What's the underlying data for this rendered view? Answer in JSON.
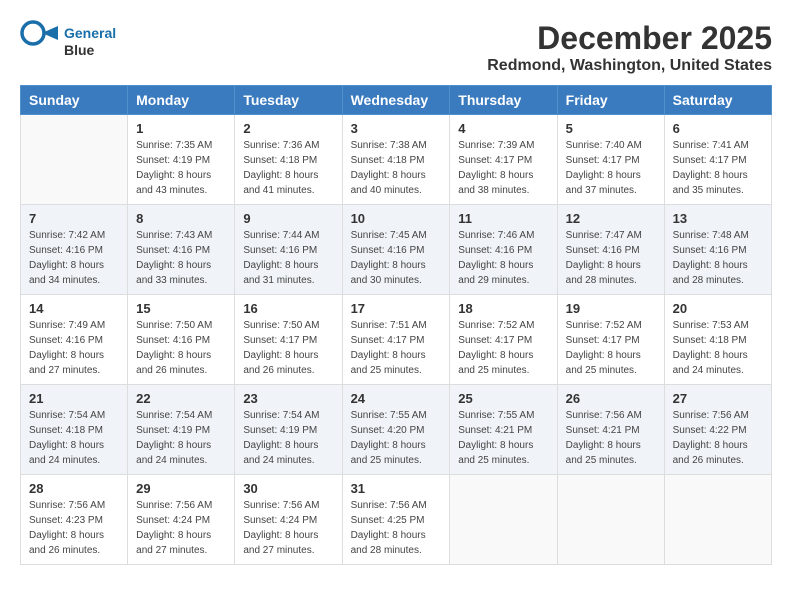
{
  "logo": {
    "line1": "General",
    "line2": "Blue"
  },
  "title": "December 2025",
  "location": "Redmond, Washington, United States",
  "weekdays": [
    "Sunday",
    "Monday",
    "Tuesday",
    "Wednesday",
    "Thursday",
    "Friday",
    "Saturday"
  ],
  "weeks": [
    [
      {
        "day": "",
        "sunrise": "",
        "sunset": "",
        "daylight": ""
      },
      {
        "day": "1",
        "sunrise": "Sunrise: 7:35 AM",
        "sunset": "Sunset: 4:19 PM",
        "daylight": "Daylight: 8 hours and 43 minutes."
      },
      {
        "day": "2",
        "sunrise": "Sunrise: 7:36 AM",
        "sunset": "Sunset: 4:18 PM",
        "daylight": "Daylight: 8 hours and 41 minutes."
      },
      {
        "day": "3",
        "sunrise": "Sunrise: 7:38 AM",
        "sunset": "Sunset: 4:18 PM",
        "daylight": "Daylight: 8 hours and 40 minutes."
      },
      {
        "day": "4",
        "sunrise": "Sunrise: 7:39 AM",
        "sunset": "Sunset: 4:17 PM",
        "daylight": "Daylight: 8 hours and 38 minutes."
      },
      {
        "day": "5",
        "sunrise": "Sunrise: 7:40 AM",
        "sunset": "Sunset: 4:17 PM",
        "daylight": "Daylight: 8 hours and 37 minutes."
      },
      {
        "day": "6",
        "sunrise": "Sunrise: 7:41 AM",
        "sunset": "Sunset: 4:17 PM",
        "daylight": "Daylight: 8 hours and 35 minutes."
      }
    ],
    [
      {
        "day": "7",
        "sunrise": "Sunrise: 7:42 AM",
        "sunset": "Sunset: 4:16 PM",
        "daylight": "Daylight: 8 hours and 34 minutes."
      },
      {
        "day": "8",
        "sunrise": "Sunrise: 7:43 AM",
        "sunset": "Sunset: 4:16 PM",
        "daylight": "Daylight: 8 hours and 33 minutes."
      },
      {
        "day": "9",
        "sunrise": "Sunrise: 7:44 AM",
        "sunset": "Sunset: 4:16 PM",
        "daylight": "Daylight: 8 hours and 31 minutes."
      },
      {
        "day": "10",
        "sunrise": "Sunrise: 7:45 AM",
        "sunset": "Sunset: 4:16 PM",
        "daylight": "Daylight: 8 hours and 30 minutes."
      },
      {
        "day": "11",
        "sunrise": "Sunrise: 7:46 AM",
        "sunset": "Sunset: 4:16 PM",
        "daylight": "Daylight: 8 hours and 29 minutes."
      },
      {
        "day": "12",
        "sunrise": "Sunrise: 7:47 AM",
        "sunset": "Sunset: 4:16 PM",
        "daylight": "Daylight: 8 hours and 28 minutes."
      },
      {
        "day": "13",
        "sunrise": "Sunrise: 7:48 AM",
        "sunset": "Sunset: 4:16 PM",
        "daylight": "Daylight: 8 hours and 28 minutes."
      }
    ],
    [
      {
        "day": "14",
        "sunrise": "Sunrise: 7:49 AM",
        "sunset": "Sunset: 4:16 PM",
        "daylight": "Daylight: 8 hours and 27 minutes."
      },
      {
        "day": "15",
        "sunrise": "Sunrise: 7:50 AM",
        "sunset": "Sunset: 4:16 PM",
        "daylight": "Daylight: 8 hours and 26 minutes."
      },
      {
        "day": "16",
        "sunrise": "Sunrise: 7:50 AM",
        "sunset": "Sunset: 4:17 PM",
        "daylight": "Daylight: 8 hours and 26 minutes."
      },
      {
        "day": "17",
        "sunrise": "Sunrise: 7:51 AM",
        "sunset": "Sunset: 4:17 PM",
        "daylight": "Daylight: 8 hours and 25 minutes."
      },
      {
        "day": "18",
        "sunrise": "Sunrise: 7:52 AM",
        "sunset": "Sunset: 4:17 PM",
        "daylight": "Daylight: 8 hours and 25 minutes."
      },
      {
        "day": "19",
        "sunrise": "Sunrise: 7:52 AM",
        "sunset": "Sunset: 4:17 PM",
        "daylight": "Daylight: 8 hours and 25 minutes."
      },
      {
        "day": "20",
        "sunrise": "Sunrise: 7:53 AM",
        "sunset": "Sunset: 4:18 PM",
        "daylight": "Daylight: 8 hours and 24 minutes."
      }
    ],
    [
      {
        "day": "21",
        "sunrise": "Sunrise: 7:54 AM",
        "sunset": "Sunset: 4:18 PM",
        "daylight": "Daylight: 8 hours and 24 minutes."
      },
      {
        "day": "22",
        "sunrise": "Sunrise: 7:54 AM",
        "sunset": "Sunset: 4:19 PM",
        "daylight": "Daylight: 8 hours and 24 minutes."
      },
      {
        "day": "23",
        "sunrise": "Sunrise: 7:54 AM",
        "sunset": "Sunset: 4:19 PM",
        "daylight": "Daylight: 8 hours and 24 minutes."
      },
      {
        "day": "24",
        "sunrise": "Sunrise: 7:55 AM",
        "sunset": "Sunset: 4:20 PM",
        "daylight": "Daylight: 8 hours and 25 minutes."
      },
      {
        "day": "25",
        "sunrise": "Sunrise: 7:55 AM",
        "sunset": "Sunset: 4:21 PM",
        "daylight": "Daylight: 8 hours and 25 minutes."
      },
      {
        "day": "26",
        "sunrise": "Sunrise: 7:56 AM",
        "sunset": "Sunset: 4:21 PM",
        "daylight": "Daylight: 8 hours and 25 minutes."
      },
      {
        "day": "27",
        "sunrise": "Sunrise: 7:56 AM",
        "sunset": "Sunset: 4:22 PM",
        "daylight": "Daylight: 8 hours and 26 minutes."
      }
    ],
    [
      {
        "day": "28",
        "sunrise": "Sunrise: 7:56 AM",
        "sunset": "Sunset: 4:23 PM",
        "daylight": "Daylight: 8 hours and 26 minutes."
      },
      {
        "day": "29",
        "sunrise": "Sunrise: 7:56 AM",
        "sunset": "Sunset: 4:24 PM",
        "daylight": "Daylight: 8 hours and 27 minutes."
      },
      {
        "day": "30",
        "sunrise": "Sunrise: 7:56 AM",
        "sunset": "Sunset: 4:24 PM",
        "daylight": "Daylight: 8 hours and 27 minutes."
      },
      {
        "day": "31",
        "sunrise": "Sunrise: 7:56 AM",
        "sunset": "Sunset: 4:25 PM",
        "daylight": "Daylight: 8 hours and 28 minutes."
      },
      {
        "day": "",
        "sunrise": "",
        "sunset": "",
        "daylight": ""
      },
      {
        "day": "",
        "sunrise": "",
        "sunset": "",
        "daylight": ""
      },
      {
        "day": "",
        "sunrise": "",
        "sunset": "",
        "daylight": ""
      }
    ]
  ]
}
